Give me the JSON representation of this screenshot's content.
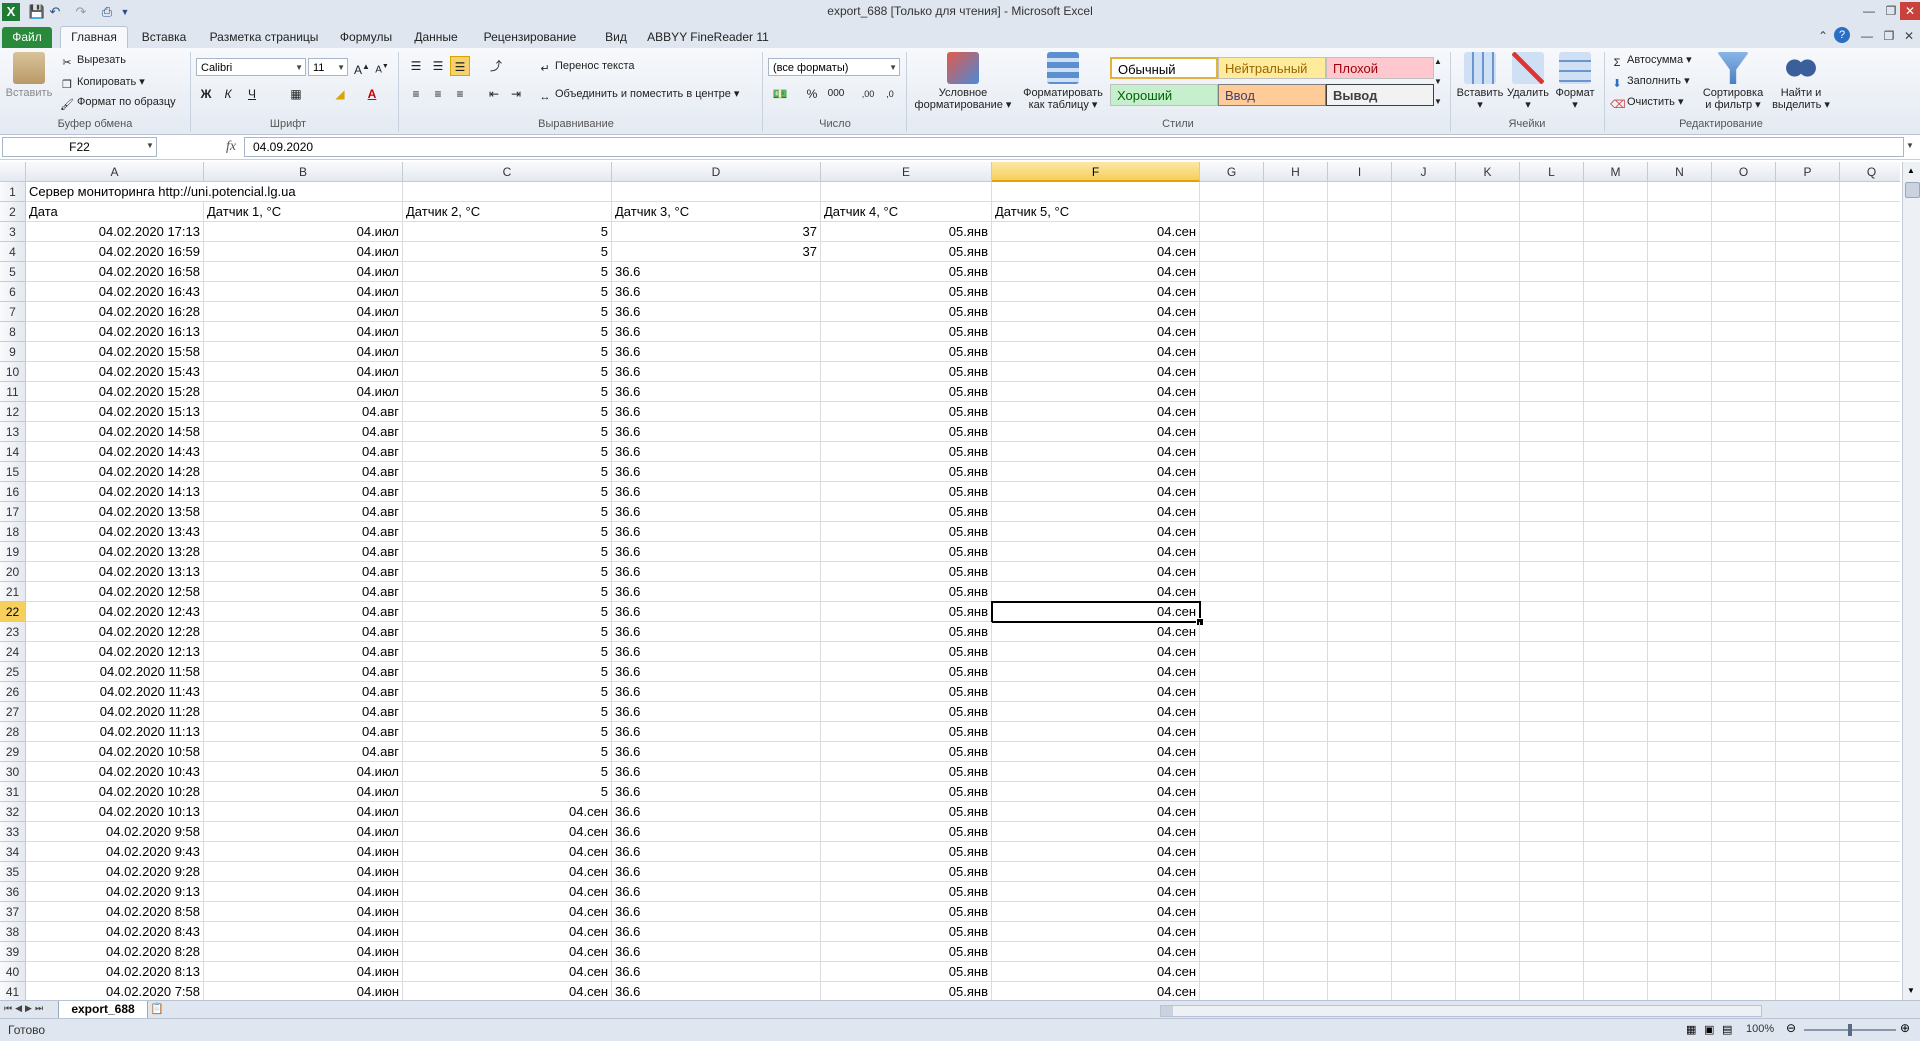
{
  "window": {
    "title": "export_688  [Только для чтения]  -  Microsoft Excel"
  },
  "tabs": [
    "Файл",
    "Главная",
    "Вставка",
    "Разметка страницы",
    "Формулы",
    "Данные",
    "Рецензирование",
    "Вид",
    "ABBYY FineReader 11"
  ],
  "ribbon": {
    "clipboard": {
      "paste": "Вставить",
      "cut": "Вырезать",
      "copy": "Копировать",
      "format_painter": "Формат по образцу",
      "label": "Буфер обмена"
    },
    "font": {
      "name": "Calibri",
      "size": "11",
      "label": "Шрифт",
      "bold": "Ж",
      "italic": "К",
      "underline": "Ч"
    },
    "alignment": {
      "wrap": "Перенос текста",
      "merge": "Объединить и поместить в центре",
      "label": "Выравнивание"
    },
    "number": {
      "format": "(все форматы)",
      "label": "Число"
    },
    "styles": {
      "conditional": [
        "Условное",
        "форматирование"
      ],
      "as_table": [
        "Форматировать",
        "как таблицу"
      ],
      "boxes": [
        "Обычный",
        "Нейтральный",
        "Плохой",
        "Хороший",
        "Ввод",
        "Вывод"
      ],
      "label": "Стили"
    },
    "cells": {
      "insert": "Вставить",
      "delete": "Удалить",
      "format": "Формат",
      "label": "Ячейки"
    },
    "editing": {
      "autosum": "Автосумма",
      "fill": "Заполнить",
      "clear": "Очистить",
      "sort": [
        "Сортировка",
        "и фильтр"
      ],
      "find": [
        "Найти и",
        "выделить"
      ],
      "label": "Редактирование"
    }
  },
  "formula_bar": {
    "name_box": "F22",
    "fx": "fx",
    "value": "04.09.2020"
  },
  "columns": [
    "A",
    "B",
    "C",
    "D",
    "E",
    "F",
    "G",
    "H",
    "I",
    "J",
    "K",
    "L",
    "M",
    "N",
    "O",
    "P",
    "Q"
  ],
  "rows": [
    {
      "n": "1",
      "a": "Сервер мониторинга http://uni.potencial.lg.ua",
      "b": "",
      "c": "",
      "d": "",
      "e": "",
      "f": ""
    },
    {
      "n": "2",
      "a": "Дата",
      "b": "Датчик 1, °C",
      "c": "Датчик 2, °C",
      "d": "Датчик 3, °C",
      "e": "Датчик 4, °C",
      "f": "Датчик 5, °C"
    },
    {
      "n": "3",
      "a": "04.02.2020 17:13",
      "b": "04.июл",
      "c": "5",
      "d": "37",
      "e": "05.янв",
      "f": "04.сен"
    },
    {
      "n": "4",
      "a": "04.02.2020 16:59",
      "b": "04.июл",
      "c": "5",
      "d": "37",
      "e": "05.янв",
      "f": "04.сен"
    },
    {
      "n": "5",
      "a": "04.02.2020 16:58",
      "b": "04.июл",
      "c": "5",
      "d": "36.6",
      "e": "05.янв",
      "f": "04.сен"
    },
    {
      "n": "6",
      "a": "04.02.2020 16:43",
      "b": "04.июл",
      "c": "5",
      "d": "36.6",
      "e": "05.янв",
      "f": "04.сен"
    },
    {
      "n": "7",
      "a": "04.02.2020 16:28",
      "b": "04.июл",
      "c": "5",
      "d": "36.6",
      "e": "05.янв",
      "f": "04.сен"
    },
    {
      "n": "8",
      "a": "04.02.2020 16:13",
      "b": "04.июл",
      "c": "5",
      "d": "36.6",
      "e": "05.янв",
      "f": "04.сен"
    },
    {
      "n": "9",
      "a": "04.02.2020 15:58",
      "b": "04.июл",
      "c": "5",
      "d": "36.6",
      "e": "05.янв",
      "f": "04.сен"
    },
    {
      "n": "10",
      "a": "04.02.2020 15:43",
      "b": "04.июл",
      "c": "5",
      "d": "36.6",
      "e": "05.янв",
      "f": "04.сен"
    },
    {
      "n": "11",
      "a": "04.02.2020 15:28",
      "b": "04.июл",
      "c": "5",
      "d": "36.6",
      "e": "05.янв",
      "f": "04.сен"
    },
    {
      "n": "12",
      "a": "04.02.2020 15:13",
      "b": "04.авг",
      "c": "5",
      "d": "36.6",
      "e": "05.янв",
      "f": "04.сен"
    },
    {
      "n": "13",
      "a": "04.02.2020 14:58",
      "b": "04.авг",
      "c": "5",
      "d": "36.6",
      "e": "05.янв",
      "f": "04.сен"
    },
    {
      "n": "14",
      "a": "04.02.2020 14:43",
      "b": "04.авг",
      "c": "5",
      "d": "36.6",
      "e": "05.янв",
      "f": "04.сен"
    },
    {
      "n": "15",
      "a": "04.02.2020 14:28",
      "b": "04.авг",
      "c": "5",
      "d": "36.6",
      "e": "05.янв",
      "f": "04.сен"
    },
    {
      "n": "16",
      "a": "04.02.2020 14:13",
      "b": "04.авг",
      "c": "5",
      "d": "36.6",
      "e": "05.янв",
      "f": "04.сен"
    },
    {
      "n": "17",
      "a": "04.02.2020 13:58",
      "b": "04.авг",
      "c": "5",
      "d": "36.6",
      "e": "05.янв",
      "f": "04.сен"
    },
    {
      "n": "18",
      "a": "04.02.2020 13:43",
      "b": "04.авг",
      "c": "5",
      "d": "36.6",
      "e": "05.янв",
      "f": "04.сен"
    },
    {
      "n": "19",
      "a": "04.02.2020 13:28",
      "b": "04.авг",
      "c": "5",
      "d": "36.6",
      "e": "05.янв",
      "f": "04.сен"
    },
    {
      "n": "20",
      "a": "04.02.2020 13:13",
      "b": "04.авг",
      "c": "5",
      "d": "36.6",
      "e": "05.янв",
      "f": "04.сен"
    },
    {
      "n": "21",
      "a": "04.02.2020 12:58",
      "b": "04.авг",
      "c": "5",
      "d": "36.6",
      "e": "05.янв",
      "f": "04.сен"
    },
    {
      "n": "22",
      "a": "04.02.2020 12:43",
      "b": "04.авг",
      "c": "5",
      "d": "36.6",
      "e": "05.янв",
      "f": "04.сен"
    },
    {
      "n": "23",
      "a": "04.02.2020 12:28",
      "b": "04.авг",
      "c": "5",
      "d": "36.6",
      "e": "05.янв",
      "f": "04.сен"
    },
    {
      "n": "24",
      "a": "04.02.2020 12:13",
      "b": "04.авг",
      "c": "5",
      "d": "36.6",
      "e": "05.янв",
      "f": "04.сен"
    },
    {
      "n": "25",
      "a": "04.02.2020 11:58",
      "b": "04.авг",
      "c": "5",
      "d": "36.6",
      "e": "05.янв",
      "f": "04.сен"
    },
    {
      "n": "26",
      "a": "04.02.2020 11:43",
      "b": "04.авг",
      "c": "5",
      "d": "36.6",
      "e": "05.янв",
      "f": "04.сен"
    },
    {
      "n": "27",
      "a": "04.02.2020 11:28",
      "b": "04.авг",
      "c": "5",
      "d": "36.6",
      "e": "05.янв",
      "f": "04.сен"
    },
    {
      "n": "28",
      "a": "04.02.2020 11:13",
      "b": "04.авг",
      "c": "5",
      "d": "36.6",
      "e": "05.янв",
      "f": "04.сен"
    },
    {
      "n": "29",
      "a": "04.02.2020 10:58",
      "b": "04.авг",
      "c": "5",
      "d": "36.6",
      "e": "05.янв",
      "f": "04.сен"
    },
    {
      "n": "30",
      "a": "04.02.2020 10:43",
      "b": "04.июл",
      "c": "5",
      "d": "36.6",
      "e": "05.янв",
      "f": "04.сен"
    },
    {
      "n": "31",
      "a": "04.02.2020 10:28",
      "b": "04.июл",
      "c": "5",
      "d": "36.6",
      "e": "05.янв",
      "f": "04.сен"
    },
    {
      "n": "32",
      "a": "04.02.2020 10:13",
      "b": "04.июл",
      "c": "04.сен",
      "d": "36.6",
      "e": "05.янв",
      "f": "04.сен"
    },
    {
      "n": "33",
      "a": "04.02.2020 9:58",
      "b": "04.июл",
      "c": "04.сен",
      "d": "36.6",
      "e": "05.янв",
      "f": "04.сен"
    },
    {
      "n": "34",
      "a": "04.02.2020 9:43",
      "b": "04.июн",
      "c": "04.сен",
      "d": "36.6",
      "e": "05.янв",
      "f": "04.сен"
    },
    {
      "n": "35",
      "a": "04.02.2020 9:28",
      "b": "04.июн",
      "c": "04.сен",
      "d": "36.6",
      "e": "05.янв",
      "f": "04.сен"
    },
    {
      "n": "36",
      "a": "04.02.2020 9:13",
      "b": "04.июн",
      "c": "04.сен",
      "d": "36.6",
      "e": "05.янв",
      "f": "04.сен"
    },
    {
      "n": "37",
      "a": "04.02.2020 8:58",
      "b": "04.июн",
      "c": "04.сен",
      "d": "36.6",
      "e": "05.янв",
      "f": "04.сен"
    },
    {
      "n": "38",
      "a": "04.02.2020 8:43",
      "b": "04.июн",
      "c": "04.сен",
      "d": "36.6",
      "e": "05.янв",
      "f": "04.сен"
    },
    {
      "n": "39",
      "a": "04.02.2020 8:28",
      "b": "04.июн",
      "c": "04.сен",
      "d": "36.6",
      "e": "05.янв",
      "f": "04.сен"
    },
    {
      "n": "40",
      "a": "04.02.2020 8:13",
      "b": "04.июн",
      "c": "04.сен",
      "d": "36.6",
      "e": "05.янв",
      "f": "04.сен"
    },
    {
      "n": "41",
      "a": "04.02.2020 7:58",
      "b": "04.июн",
      "c": "04.сен",
      "d": "36.6",
      "e": "05.янв",
      "f": "04.сен"
    }
  ],
  "selection": {
    "row": "22",
    "col": "F"
  },
  "sheet_tab": "export_688",
  "status": {
    "ready": "Готово",
    "zoom": "100%"
  },
  "colors": {
    "accent_file": "#2a8a3c",
    "selected_header": "#f6cf5c"
  }
}
